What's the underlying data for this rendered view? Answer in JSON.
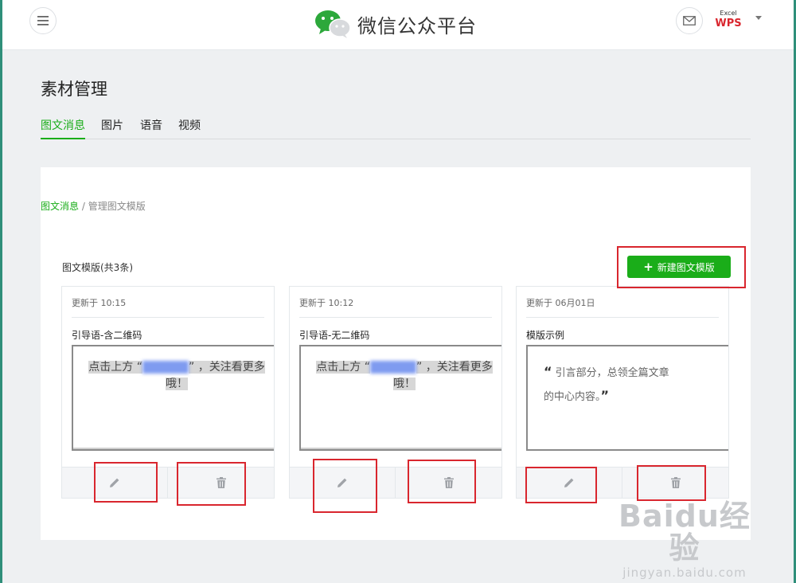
{
  "header": {
    "brand_title": "微信公众平台",
    "wps_excel": "Excel",
    "wps_mark": "WPS"
  },
  "page": {
    "title": "素材管理",
    "tabs": [
      {
        "label": "图文消息",
        "active": true
      },
      {
        "label": "图片",
        "active": false
      },
      {
        "label": "语音",
        "active": false
      },
      {
        "label": "视频",
        "active": false
      }
    ]
  },
  "breadcrumb": {
    "link": "图文消息",
    "separator": " / ",
    "current": "管理图文模版"
  },
  "templates": {
    "count_label": "图文模版(共3条)",
    "new_button": "新建图文模版",
    "cards": [
      {
        "updated": "更新于 10:15",
        "name": "引导语-含二维码",
        "preview_before": "点击上方 “",
        "preview_blurred": "xxxxxxx",
        "preview_after": "” ，关注看更多",
        "preview_line2": "哦！"
      },
      {
        "updated": "更新于 10:12",
        "name": "引导语-无二维码",
        "preview_before": "点击上方 “",
        "preview_blurred": "xxxxxxx",
        "preview_after": "” ，关注看更多",
        "preview_line2": "哦！"
      },
      {
        "updated": "更新于 06月01日",
        "name": "模版示例",
        "quote_open": "“",
        "quote_text_1": " 引言部分，总领全篇文章",
        "quote_text_2": "的中心内容。",
        "quote_close": "”"
      }
    ]
  },
  "icons": {
    "menu": "menu-icon",
    "logo": "wechat-logo",
    "mail": "mail-icon",
    "edit": "pencil-icon",
    "delete": "trash-icon"
  },
  "colors": {
    "accent": "#1aad19",
    "annotation": "#d9262e"
  },
  "watermark": {
    "brand": "Baidu经验",
    "url": "jingyan.baidu.com"
  }
}
